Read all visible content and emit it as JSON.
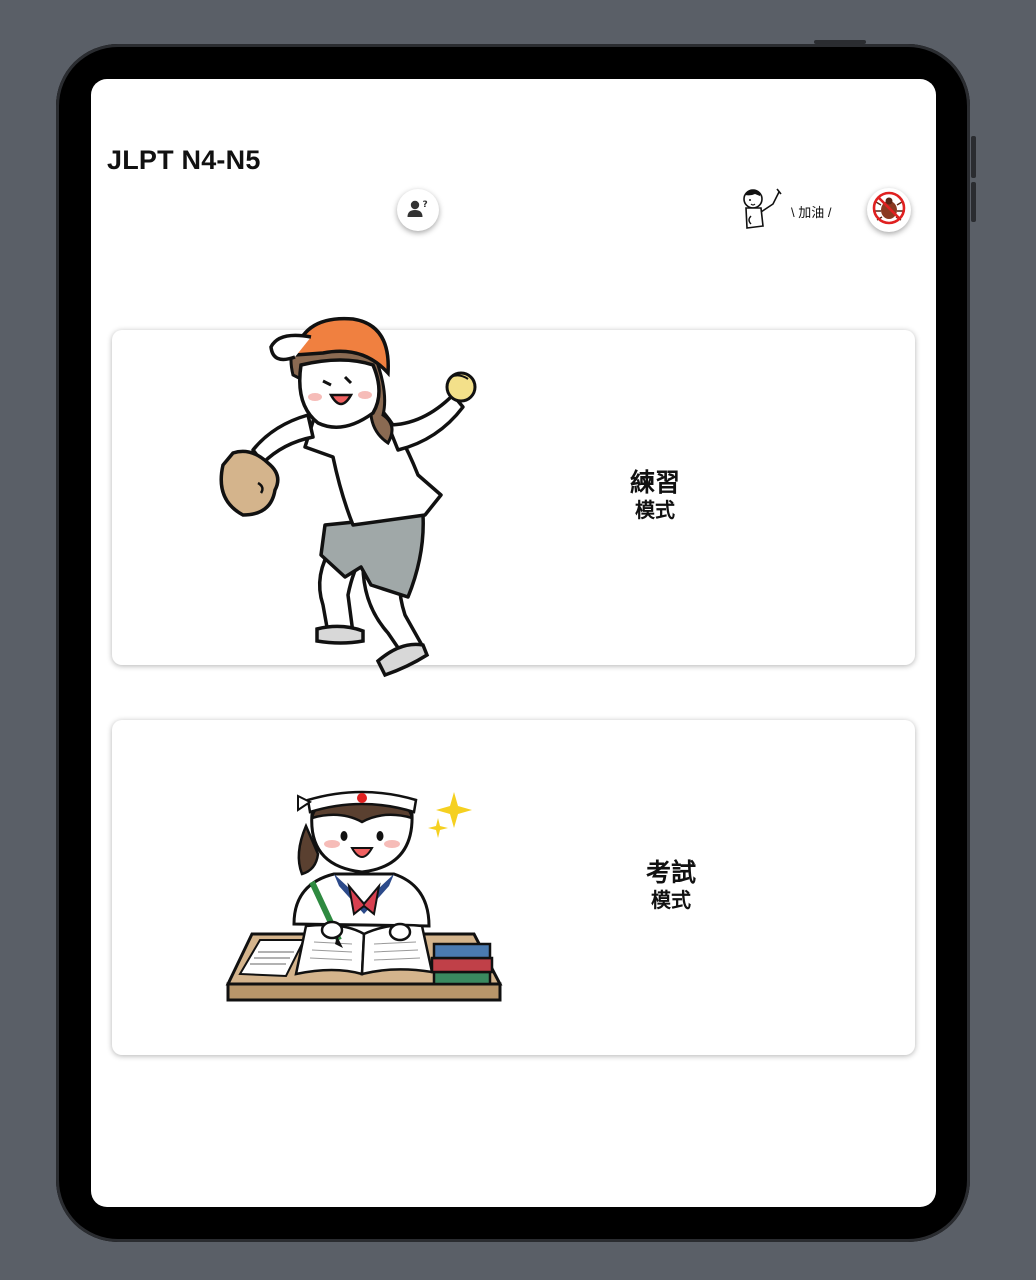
{
  "app": {
    "title": "JLPT N4-N5"
  },
  "header": {
    "cheer_text": "\\ 加油 /",
    "icons": {
      "account": "person-question-icon",
      "cheer": "pointing-boy-icon",
      "no_ads": "no-bug-icon"
    }
  },
  "cards": [
    {
      "label_main": "練習",
      "label_sub": "模式",
      "illustration": "baseball-girl-illustration"
    },
    {
      "label_main": "考試",
      "label_sub": "模式",
      "illustration": "studying-girl-illustration"
    }
  ],
  "colors": {
    "background": "#5a5f67",
    "cap_orange": "#f08040",
    "glove_tan": "#d4b48c",
    "shorts_gray": "#a0a8a8",
    "sparkle_yellow": "#f5d020"
  }
}
